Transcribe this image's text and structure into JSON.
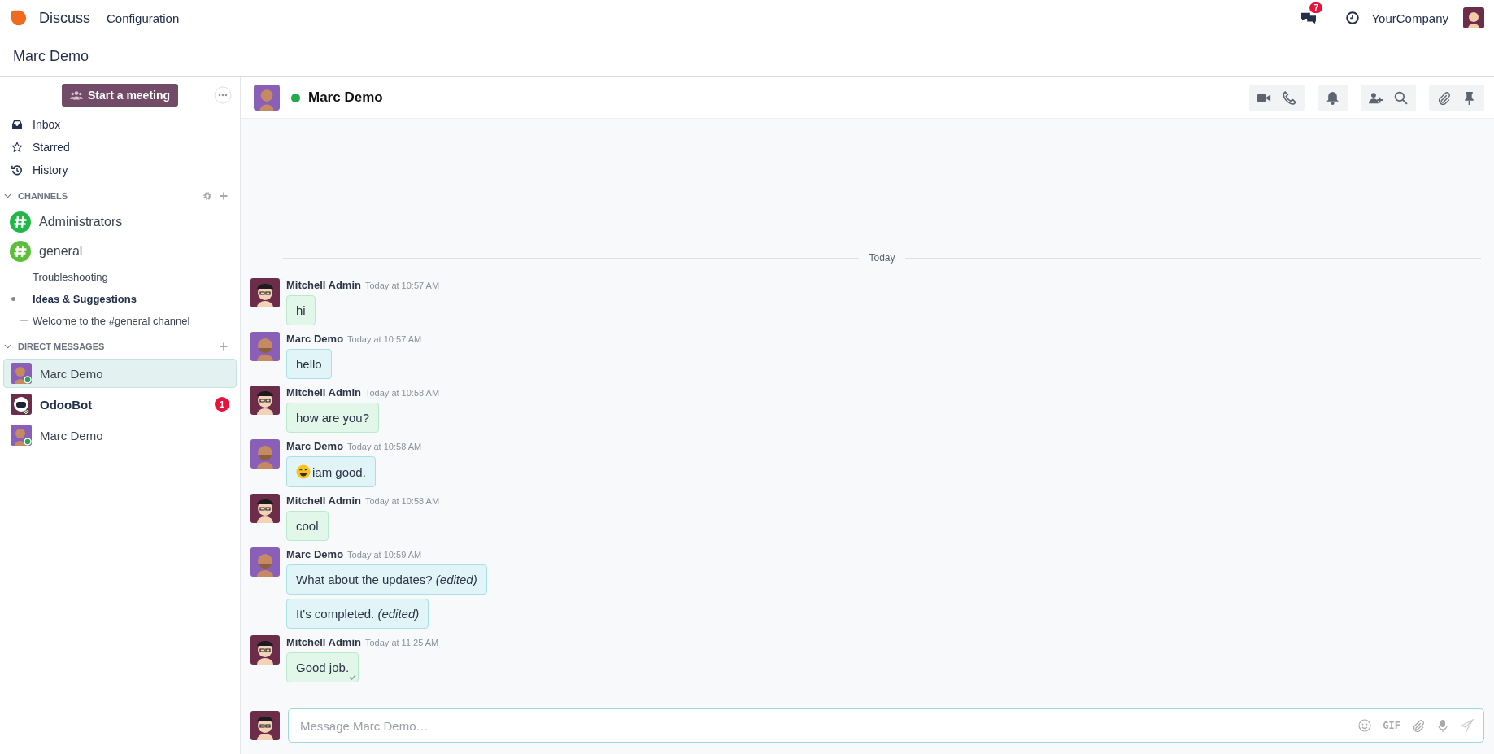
{
  "navbar": {
    "app_name": "Discuss",
    "menu": [
      "Configuration"
    ],
    "messages_badge": "7",
    "company": "YourCompany"
  },
  "breadcrumb": "Marc Demo",
  "sidebar": {
    "start_meeting": "Start a meeting",
    "mailboxes": [
      {
        "kind": "inbox",
        "label": "Inbox"
      },
      {
        "kind": "starred",
        "label": "Starred"
      },
      {
        "kind": "history",
        "label": "History"
      }
    ],
    "channels_heading": "CHANNELS",
    "channels": [
      {
        "name": "Administrators",
        "color": "#21b849"
      },
      {
        "name": "general",
        "color": "#5cbf3a",
        "children": [
          {
            "name": "Troubleshooting",
            "unread": false
          },
          {
            "name": "Ideas & Suggestions",
            "unread": true
          },
          {
            "name": "Welcome to the #general channel",
            "unread": false
          }
        ]
      }
    ],
    "dm_heading": "DIRECT MESSAGES",
    "direct_messages": [
      {
        "name": "Marc Demo",
        "kind": "person",
        "selected": true,
        "unread": false
      },
      {
        "name": "OdooBot",
        "kind": "bot",
        "selected": false,
        "unread": true,
        "badge": "1"
      },
      {
        "name": "Marc Demo",
        "kind": "person",
        "selected": false,
        "unread": false
      }
    ]
  },
  "chat": {
    "title": "Marc Demo",
    "online": true,
    "divider": "Today",
    "messages": [
      {
        "author": "Mitchell Admin",
        "own": true,
        "time": "Today at 10:57 AM",
        "bodies": [
          "hi"
        ]
      },
      {
        "author": "Marc Demo",
        "own": false,
        "time": "Today at 10:57 AM",
        "bodies": [
          "hello"
        ]
      },
      {
        "author": "Mitchell Admin",
        "own": true,
        "time": "Today at 10:58 AM",
        "bodies": [
          "how are you?"
        ]
      },
      {
        "author": "Marc Demo",
        "own": false,
        "time": "Today at 10:58 AM",
        "bodies": [
          "iam good."
        ],
        "emoji": true
      },
      {
        "author": "Mitchell Admin",
        "own": true,
        "time": "Today at 10:58 AM",
        "bodies": [
          "cool"
        ]
      },
      {
        "author": "Marc Demo",
        "own": false,
        "time": "Today at 10:59 AM",
        "bodies": [
          "What about the updates? *(edited)*",
          "It's completed. *(edited)*"
        ]
      },
      {
        "author": "Mitchell Admin",
        "own": true,
        "time": "Today at 11:25 AM",
        "bodies": [
          "Good job."
        ],
        "seen": true
      }
    ],
    "composer": {
      "placeholder": "Message Marc Demo…",
      "gif": "GIF"
    }
  }
}
